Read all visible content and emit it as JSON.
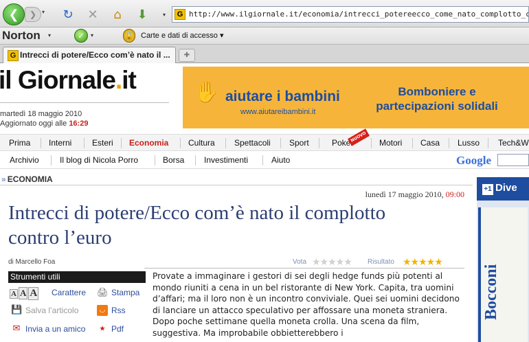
{
  "browser": {
    "url": "http://www.ilgiornale.it/economia/intrecci_potereecco_come_nato_complotto_contro_leuro/17-05-",
    "toolbar": {
      "norton": "Norton",
      "carte": "Carte e dati di accesso"
    },
    "tab_title": "Intrecci di potere/Ecco com’è nato il ..."
  },
  "site": {
    "logo_main": "il Giornale",
    "logo_dot": ".",
    "logo_tld": "it",
    "date": "martedì 18 maggio 2010",
    "updated_label": "Aggiornato oggi alle",
    "updated_time": "16:29"
  },
  "banner": {
    "brand": "aiutare i bambini",
    "url": "www.aiutareibambini.it",
    "line1": "Bomboniere e",
    "line2": "partecipazioni solidali"
  },
  "nav": {
    "primary": [
      "Prima",
      "Interni",
      "Esteri",
      "Economia",
      "Cultura",
      "Spettacoli",
      "Sport",
      "Poker",
      "Motori",
      "Casa",
      "Lusso",
      "Tech&W"
    ],
    "poker_badge": "NUOVO",
    "secondary": [
      "Archivio",
      "Il blog di Nicola Porro",
      "Borsa",
      "Investimenti",
      "Aiuto"
    ],
    "search_brand": "Google"
  },
  "article": {
    "section": "ECONOMIA",
    "date": "lunedì 17 maggio 2010,",
    "time": "09:00",
    "title": "Intrecci di potere/Ecco com’è nato il complotto contro l’euro",
    "author": "di Marcello Foa",
    "vota_label": "Vota",
    "risultato_label": "Risultato",
    "rating": 5,
    "body": "Provate a immaginare i gestori di sei degli hedge funds più potenti al mondo riuniti a cena in un bel ristorante di New York. Capita, tra uomini d’affari; ma il loro non è un incontro conviviale. Quei sei uomini decidono di lanciare un attacco speculativo per affossare una moneta straniera. Dopo poche settimane quella moneta crolla. Una scena da film, suggestiva. Ma improbabile obbietterebbero i"
  },
  "tools": {
    "header": "Strumenti utili",
    "aaa": [
      "A",
      "A",
      "A"
    ],
    "carattere": "Carattere",
    "stampa": "Stampa",
    "salva": "Salva l’articolo",
    "rss": "Rss",
    "invia": "Invia a un amico",
    "pdf": "Pdf"
  },
  "side_ad": {
    "top": "Dive",
    "brand": "Bocconi"
  }
}
